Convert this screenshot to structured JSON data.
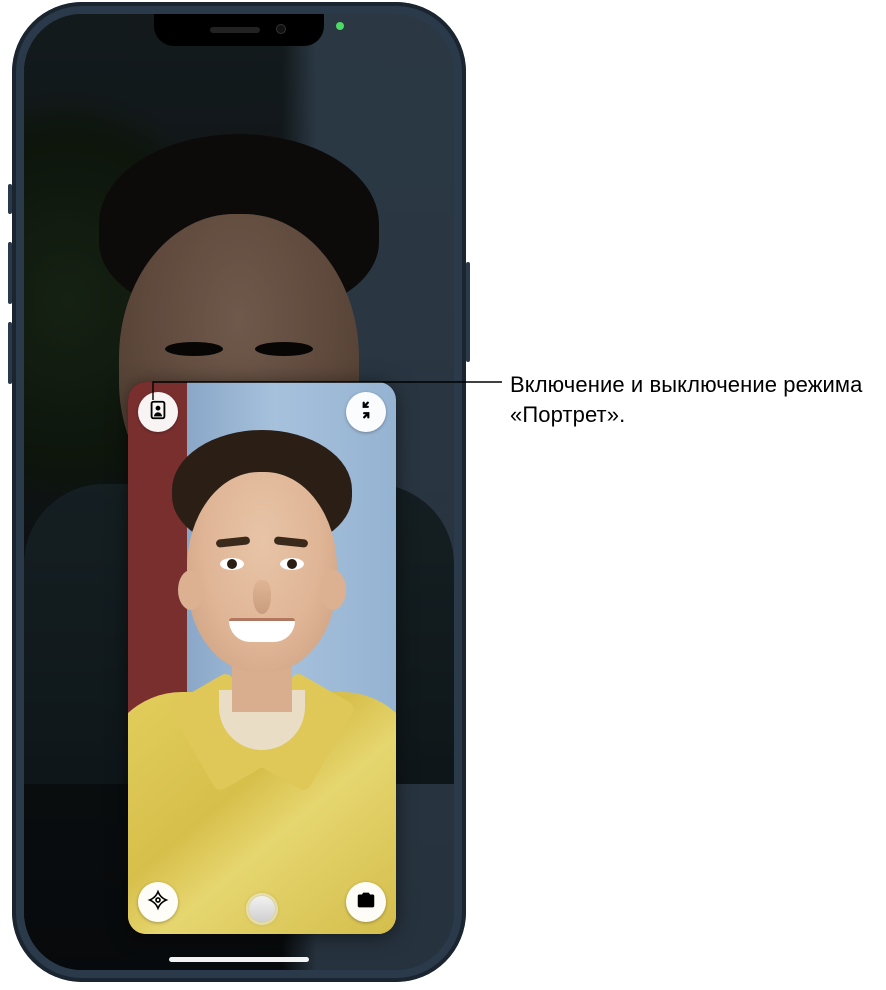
{
  "callout": {
    "text": "Включение и выключение режима «Портрет»."
  },
  "pip_controls": {
    "portrait_mode": "portrait-mode",
    "minimize": "minimize",
    "effects": "effects",
    "zoom": "zoom",
    "switch_camera": "switch-camera"
  },
  "colors": {
    "privacy_indicator": "#4cd964",
    "bezel": "#2a3a4a"
  }
}
